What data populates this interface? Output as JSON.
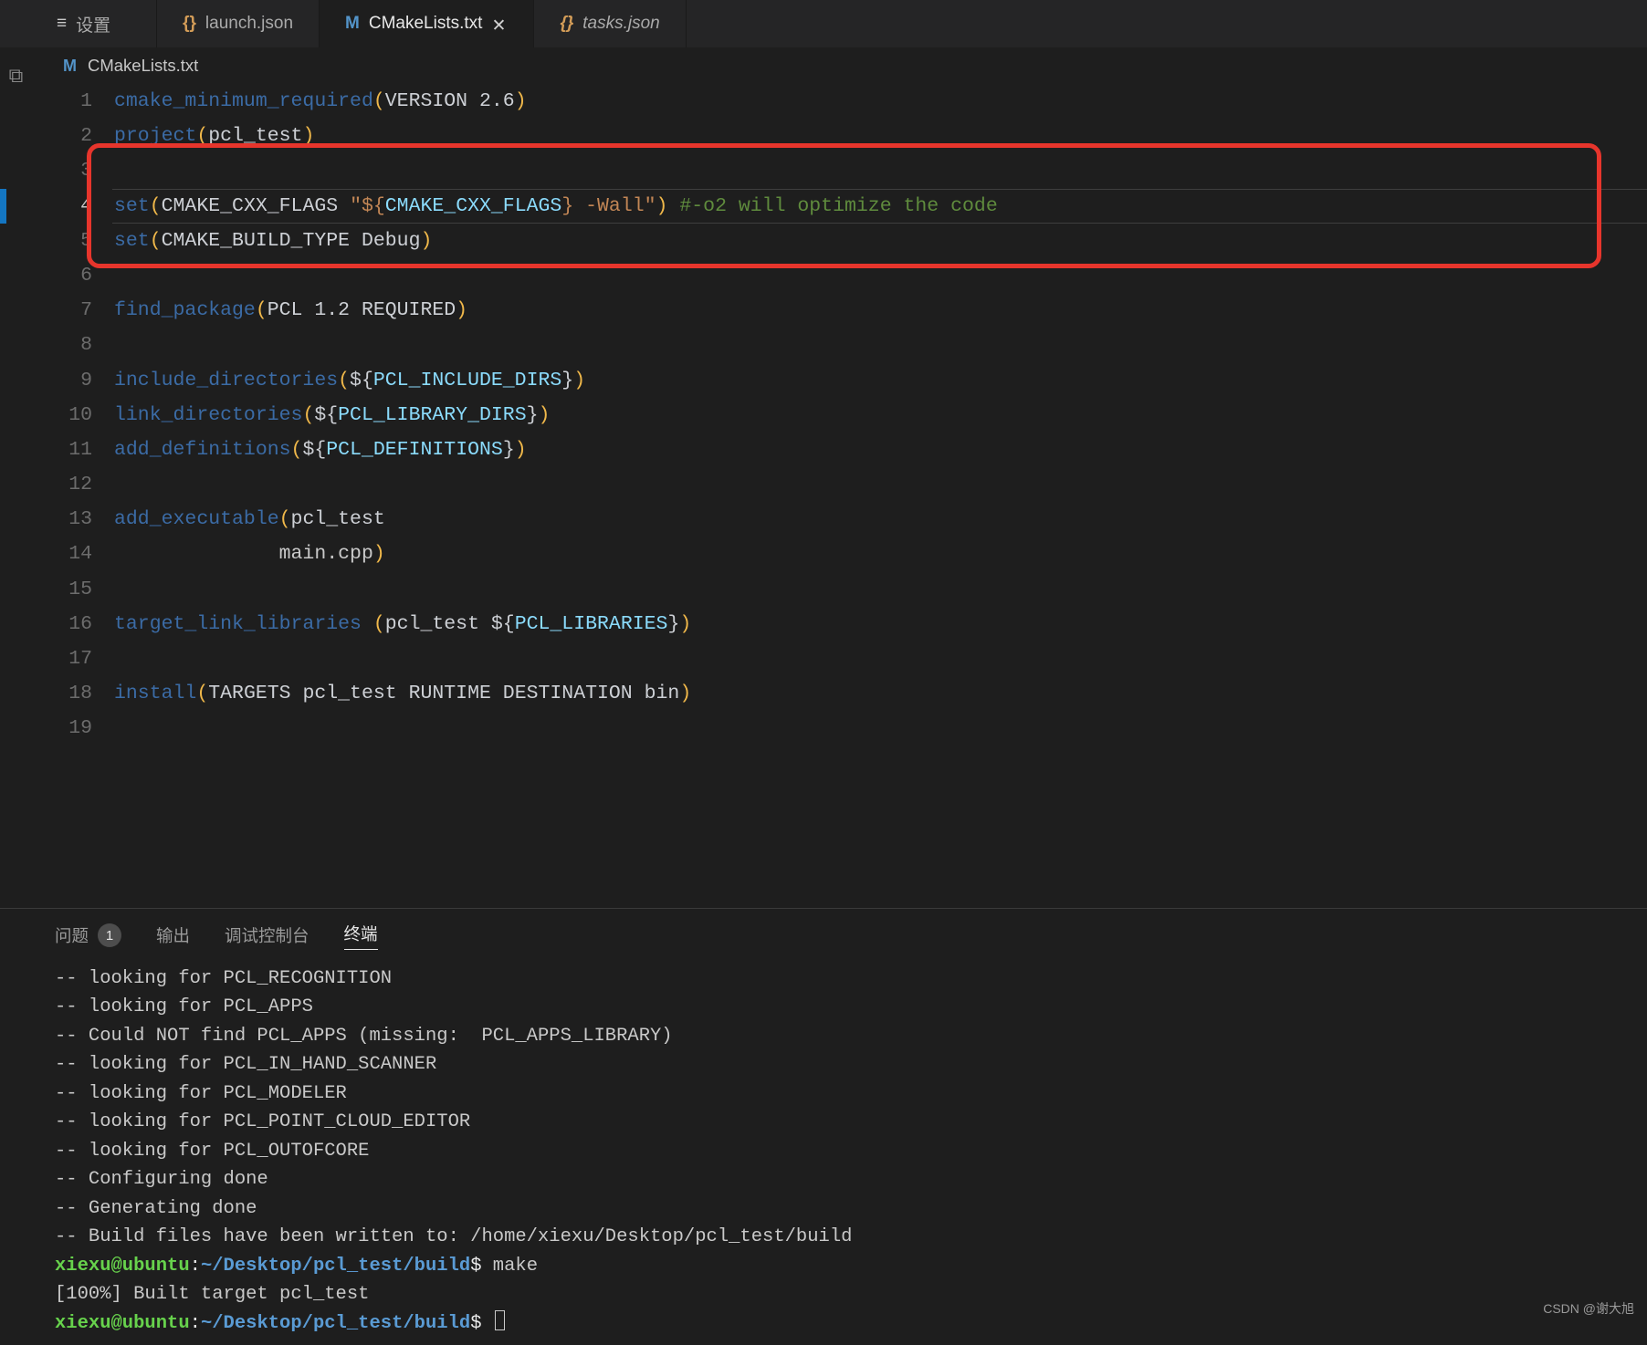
{
  "tabs": [
    {
      "label": "设置",
      "icon": "gear",
      "italic": false,
      "active": false,
      "closeable": false
    },
    {
      "label": "launch.json",
      "icon": "json",
      "italic": false,
      "active": false,
      "closeable": false
    },
    {
      "label": "CMakeLists.txt",
      "icon": "m",
      "italic": false,
      "active": true,
      "closeable": true
    },
    {
      "label": "tasks.json",
      "icon": "json",
      "italic": true,
      "active": false,
      "closeable": false
    }
  ],
  "breadcrumb": {
    "icon": "m",
    "label": "CMakeLists.txt"
  },
  "current_line": 4,
  "lines": [
    {
      "n": 1,
      "t": [
        [
          "k-fn",
          "cmake_minimum_required"
        ],
        [
          "k-par",
          "("
        ],
        [
          "k-kw",
          "VERSION 2.6"
        ],
        [
          "k-par",
          ")"
        ]
      ]
    },
    {
      "n": 2,
      "t": [
        [
          "k-fn",
          "project"
        ],
        [
          "k-par",
          "("
        ],
        [
          "k-kw",
          "pcl_test"
        ],
        [
          "k-par",
          ")"
        ]
      ]
    },
    {
      "n": 3,
      "t": []
    },
    {
      "n": 4,
      "t": [
        [
          "k-fn",
          "set"
        ],
        [
          "k-par",
          "("
        ],
        [
          "k-kw",
          "CMAKE_CXX_FLAGS "
        ],
        [
          "k-str",
          "\"${"
        ],
        [
          "k-var",
          "CMAKE_CXX_FLAGS"
        ],
        [
          "k-str",
          "} -Wall\""
        ],
        [
          "k-par",
          ")"
        ],
        [
          "k-kw",
          " "
        ],
        [
          "k-cmt",
          "#-o2 will optimize the code"
        ]
      ]
    },
    {
      "n": 5,
      "t": [
        [
          "k-fn",
          "set"
        ],
        [
          "k-par",
          "("
        ],
        [
          "k-kw",
          "CMAKE_BUILD_TYPE Debug"
        ],
        [
          "k-par",
          ")"
        ]
      ]
    },
    {
      "n": 6,
      "t": []
    },
    {
      "n": 7,
      "t": [
        [
          "k-fn",
          "find_package"
        ],
        [
          "k-par",
          "("
        ],
        [
          "k-kw",
          "PCL 1.2 REQUIRED"
        ],
        [
          "k-par",
          ")"
        ]
      ]
    },
    {
      "n": 8,
      "t": []
    },
    {
      "n": 9,
      "t": [
        [
          "k-fn",
          "include_directories"
        ],
        [
          "k-par",
          "("
        ],
        [
          "k-kw",
          "${"
        ],
        [
          "k-var",
          "PCL_INCLUDE_DIRS"
        ],
        [
          "k-kw",
          "}"
        ],
        [
          "k-par",
          ")"
        ]
      ]
    },
    {
      "n": 10,
      "t": [
        [
          "k-fn",
          "link_directories"
        ],
        [
          "k-par",
          "("
        ],
        [
          "k-kw",
          "${"
        ],
        [
          "k-var",
          "PCL_LIBRARY_DIRS"
        ],
        [
          "k-kw",
          "}"
        ],
        [
          "k-par",
          ")"
        ]
      ]
    },
    {
      "n": 11,
      "t": [
        [
          "k-fn",
          "add_definitions"
        ],
        [
          "k-par",
          "("
        ],
        [
          "k-kw",
          "${"
        ],
        [
          "k-var",
          "PCL_DEFINITIONS"
        ],
        [
          "k-kw",
          "}"
        ],
        [
          "k-par",
          ")"
        ]
      ]
    },
    {
      "n": 12,
      "t": []
    },
    {
      "n": 13,
      "t": [
        [
          "k-fn",
          "add_executable"
        ],
        [
          "k-par",
          "("
        ],
        [
          "k-kw",
          "pcl_test"
        ]
      ]
    },
    {
      "n": 14,
      "t": [
        [
          "k-dim",
          "              main.cpp"
        ],
        [
          "k-par",
          ")"
        ]
      ]
    },
    {
      "n": 15,
      "t": []
    },
    {
      "n": 16,
      "t": [
        [
          "k-fn",
          "target_link_libraries"
        ],
        [
          "k-kw",
          " "
        ],
        [
          "k-par",
          "("
        ],
        [
          "k-kw",
          "pcl_test ${"
        ],
        [
          "k-var",
          "PCL_LIBRARIES"
        ],
        [
          "k-kw",
          "}"
        ],
        [
          "k-par",
          ")"
        ]
      ]
    },
    {
      "n": 17,
      "t": []
    },
    {
      "n": 18,
      "t": [
        [
          "k-fn",
          "install"
        ],
        [
          "k-par",
          "("
        ],
        [
          "k-kw",
          "TARGETS pcl_test RUNTIME DESTINATION bin"
        ],
        [
          "k-par",
          ")"
        ]
      ]
    },
    {
      "n": 19,
      "t": []
    }
  ],
  "highlight_box": {
    "top_line": 3,
    "bottom_line": 6
  },
  "panel": {
    "tabs": [
      {
        "label": "问题",
        "badge": "1",
        "active": false
      },
      {
        "label": "输出",
        "active": false
      },
      {
        "label": "调试控制台",
        "active": false
      },
      {
        "label": "终端",
        "active": true
      }
    ],
    "terminal": [
      [
        [
          "",
          "-- looking for PCL_RECOGNITION"
        ]
      ],
      [
        [
          "",
          "-- looking for PCL_APPS"
        ]
      ],
      [
        [
          "",
          "-- Could NOT find PCL_APPS (missing:  PCL_APPS_LIBRARY)"
        ]
      ],
      [
        [
          "",
          "-- looking for PCL_IN_HAND_SCANNER"
        ]
      ],
      [
        [
          "",
          "-- looking for PCL_MODELER"
        ]
      ],
      [
        [
          "",
          "-- looking for PCL_POINT_CLOUD_EDITOR"
        ]
      ],
      [
        [
          "",
          "-- looking for PCL_OUTOFCORE"
        ]
      ],
      [
        [
          "",
          "-- Configuring done"
        ]
      ],
      [
        [
          "",
          "-- Generating done"
        ]
      ],
      [
        [
          "",
          "-- Build files have been written to: /home/xiexu/Desktop/pcl_test/build"
        ]
      ],
      [
        [
          "t-user",
          "xiexu@ubuntu"
        ],
        [
          "t-w",
          ":"
        ],
        [
          "t-path",
          "~/Desktop/pcl_test/build"
        ],
        [
          "t-w",
          "$ "
        ],
        [
          "",
          "make"
        ]
      ],
      [
        [
          "",
          "[100%] Built target pcl_test"
        ]
      ],
      [
        [
          "t-user",
          "xiexu@ubuntu"
        ],
        [
          "t-w",
          ":"
        ],
        [
          "t-path",
          "~/Desktop/pcl_test/build"
        ],
        [
          "t-w",
          "$ "
        ],
        [
          "cursor",
          ""
        ]
      ]
    ]
  },
  "watermark": "CSDN @谢大旭"
}
